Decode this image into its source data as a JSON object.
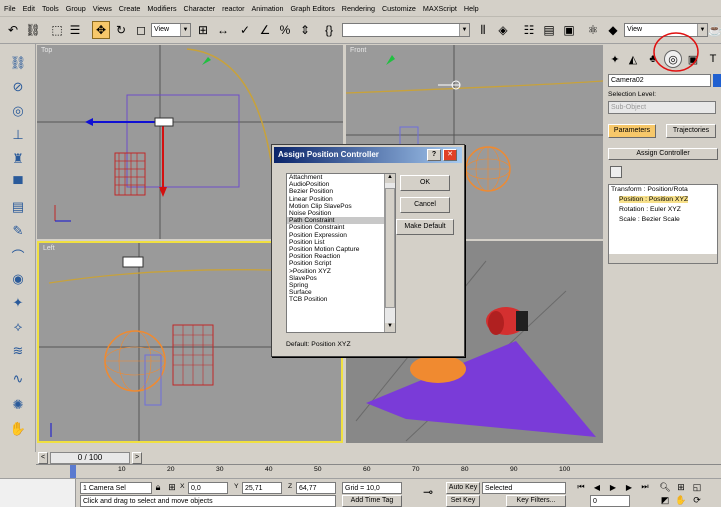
{
  "menu": [
    "File",
    "Edit",
    "Tools",
    "Group",
    "Views",
    "Create",
    "Modifiers",
    "Character",
    "reactor",
    "Animation",
    "Graph Editors",
    "Rendering",
    "Customize",
    "MAXScript",
    "Help"
  ],
  "toolbar": {
    "view_dropdown_1": "View",
    "view_dropdown_2": "View"
  },
  "viewports": {
    "top": "Top",
    "front": "Front",
    "left": "Left"
  },
  "command_panel": {
    "object_name": "Camera02",
    "selection_level_label": "Selection Level:",
    "sub_object": "Sub-Object",
    "tabs": [
      "Parameters",
      "Trajectories"
    ],
    "rollout_title": "Assign Controller",
    "tree": [
      "Transform : Position/Rota",
      "Position : Position XYZ",
      "Rotation : Euler XYZ",
      "Scale : Bezier Scale"
    ]
  },
  "dialog": {
    "title": "Assign Position Controller",
    "items": [
      "Attachment",
      "AudioPosition",
      "Bezier Position",
      "Linear Position",
      "Motion Clip SlavePos",
      "Noise Position",
      "Path Constraint",
      "Position Constraint",
      "Position Expression",
      "Position List",
      "Position Motion Capture",
      "Position Reaction",
      "Position Script",
      ">Position XYZ",
      "SlavePos",
      "Spring",
      "Surface",
      "TCB Position"
    ],
    "selected_index": 6,
    "ok_label": "OK",
    "cancel_label": "Cancel",
    "make_default_label": "Make Default",
    "default_text": "Default: Position XYZ",
    "help_glyph": "?",
    "close_glyph": "✕"
  },
  "timeline": {
    "frame_label": "0 / 100",
    "ticks": [
      "10",
      "20",
      "30",
      "40",
      "50",
      "60",
      "70",
      "80",
      "90",
      "100"
    ]
  },
  "status": {
    "selection": "1 Camera Sel",
    "x_label": "X",
    "x_value": "0,0",
    "y_label": "Y",
    "y_value": "25,71",
    "z_label": "Z",
    "z_value": "64,77",
    "grid": "Grid = 10,0",
    "prompt": "Click and drag to select and move objects",
    "add_time_tag": "Add Time Tag",
    "auto_key": "Auto Key",
    "set_key": "Set Key",
    "key_mode": "Selected",
    "key_filters": "Key Filters...",
    "frame_value": "0"
  },
  "colors": {
    "ui": "#d4d0c8",
    "viewport_bg": "#9a9a9a",
    "active_border": "#f0e040",
    "title_bar": "#0a246a",
    "tab_active": "#f7c86a",
    "orange_sphere": "#f08a30",
    "purple_plane": "#7a3bd8",
    "red_object": "#d43030"
  }
}
